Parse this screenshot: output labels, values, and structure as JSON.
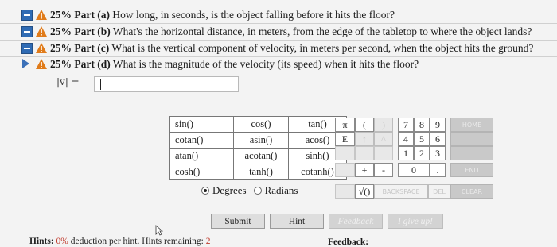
{
  "parts": [
    {
      "pct": "25%",
      "label": "Part (a)",
      "question": "How long, in seconds, is the object falling before it hits the floor?",
      "state": "collapsed"
    },
    {
      "pct": "25%",
      "label": "Part (b)",
      "question": "What's the horizontal distance, in meters, from the edge of the tabletop to where the object lands?",
      "state": "collapsed"
    },
    {
      "pct": "25%",
      "label": "Part (c)",
      "question": "What is the vertical component of velocity, in meters per second, when the object hits the ground?",
      "state": "collapsed"
    },
    {
      "pct": "25%",
      "label": "Part (d)",
      "question": "What is the magnitude of the velocity (its speed) when it hits the floor?",
      "state": "active"
    }
  ],
  "answer": {
    "label": "|v| =",
    "value": ""
  },
  "functions": [
    [
      "sin()",
      "cos()",
      "tan()"
    ],
    [
      "cotan()",
      "asin()",
      "acos()"
    ],
    [
      "atan()",
      "acotan()",
      "sinh()"
    ],
    [
      "cosh()",
      "tanh()",
      "cotanh()"
    ]
  ],
  "angle_mode": {
    "degrees": "Degrees",
    "radians": "Radians",
    "selected": "degrees"
  },
  "keypad": {
    "pi": "π",
    "lparen": "(",
    "rparen": ")",
    "e": "E",
    "up": "↑",
    "left": "^",
    "k7": "7",
    "k8": "8",
    "k9": "9",
    "k4": "4",
    "k5": "5",
    "k6": "6",
    "k1": "1",
    "k2": "2",
    "k3": "3",
    "k0": "0",
    "dot": ".",
    "plus": "+",
    "minus": "-",
    "sqrt": "√()",
    "home": "HOME",
    "end": "END",
    "backspace": "BACKSPACE",
    "del": "DEL",
    "clear": "CLEAR"
  },
  "buttons": {
    "submit": "Submit",
    "hint": "Hint",
    "feedback": "Feedback",
    "give_up": "I give up!"
  },
  "hints": {
    "prefix": "Hints:",
    "pct": "0%",
    "middle": "deduction per hint. Hints remaining:",
    "remaining": "2"
  },
  "feedback_label": "Feedback:",
  "colors": {
    "accent_blue": "#2f6bb4",
    "warning_orange": "#e07b1a",
    "hint_red": "#c0392b"
  }
}
